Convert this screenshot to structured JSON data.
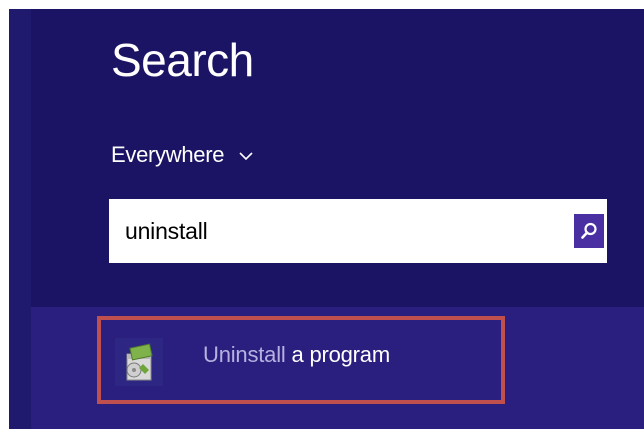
{
  "search_pane": {
    "title": "Search",
    "scope": {
      "label": "Everywhere",
      "icon": "chevron-down-icon"
    },
    "query": "uninstall",
    "search_button_icon": "magnifier-icon",
    "colors": {
      "background": "#1b1464",
      "results_band": "#2a1f7e",
      "search_button": "#4a2fa3",
      "match_text": "#b7b1e0",
      "highlight_border": "#c0504d"
    }
  },
  "results": [
    {
      "match_text": "Uninstall",
      "rest_text": " a program",
      "icon": "uninstall-program-icon"
    }
  ]
}
